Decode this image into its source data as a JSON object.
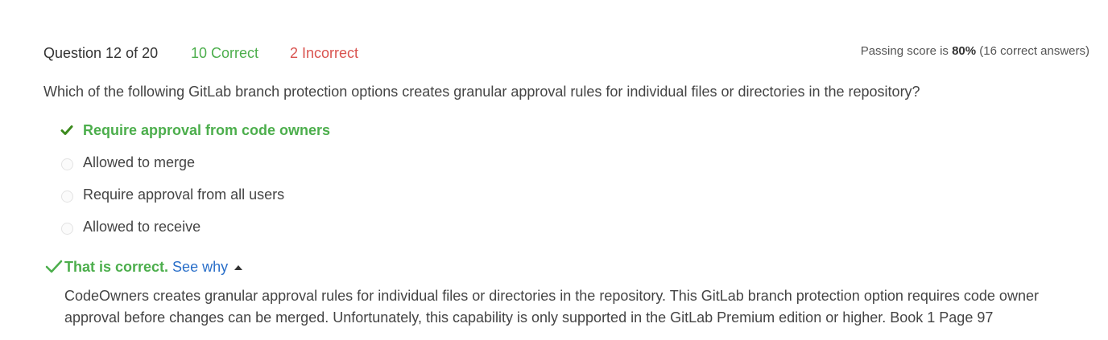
{
  "header": {
    "question_counter": "Question 12 of 20",
    "correct_count": "10 Correct",
    "incorrect_count": "2 Incorrect",
    "passing_prefix": "Passing score is ",
    "passing_percent": "80%",
    "passing_suffix": " (16 correct answers)"
  },
  "question": {
    "text": "Which of the following GitLab branch protection options creates granular approval rules for individual files or directories in the repository?"
  },
  "options": [
    {
      "label": "Require approval from code owners",
      "state": "correct"
    },
    {
      "label": "Allowed to merge",
      "state": "unselected"
    },
    {
      "label": "Require approval from all users",
      "state": "unselected"
    },
    {
      "label": "Allowed to receive",
      "state": "unselected"
    }
  ],
  "feedback": {
    "verdict": "That is correct.",
    "see_why": "See why",
    "explanation": "CodeOwners creates granular approval rules for individual files or directories in the repository. This GitLab branch protection option requires code owner approval before changes can be merged. Unfortunately, this capability is only supported in the GitLab Premium edition or higher. Book 1 Page 97"
  },
  "colors": {
    "correct": "#4cae4c",
    "incorrect": "#d9534f",
    "link": "#2a6fc9",
    "text": "#444444"
  },
  "icons": {
    "correct_option": "checkmark-icon",
    "unselected_option": "radio-empty-icon",
    "verdict": "checkmark-icon",
    "toggle": "caret-up-icon"
  }
}
